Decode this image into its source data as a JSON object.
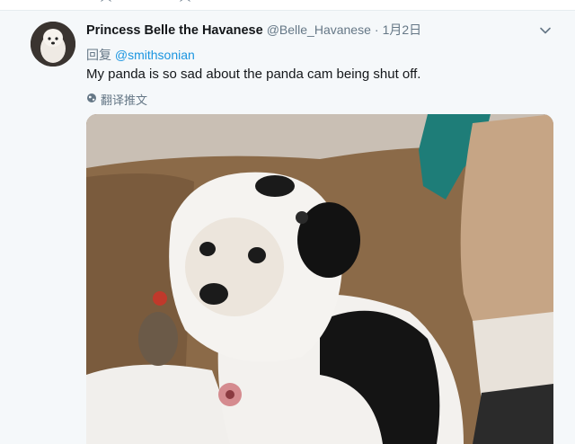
{
  "tweet": {
    "display_name": "Princess Belle the Havanese",
    "handle": "@Belle_Havanese",
    "separator": "·",
    "date": "1月2日",
    "reply_label": "回复",
    "reply_to": "@smithsonian",
    "text": "My panda is so sad about the panda cam being shut off.",
    "translate_label": "翻译推文"
  },
  "icons": {
    "menu": "chevron-down-icon",
    "translate": "globe-icon"
  },
  "colors": {
    "link": "#1b95e0",
    "muted": "#657786",
    "background": "#f5f8fa"
  }
}
